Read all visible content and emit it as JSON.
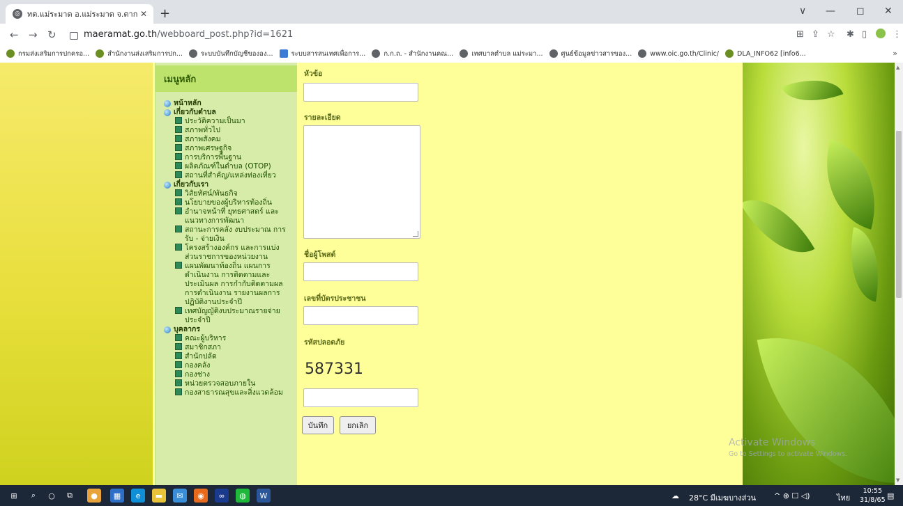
{
  "browser": {
    "tab_title": "ทต.แม่ระมาด อ.แม่ระมาด จ.ตาก - ma",
    "new_tab": "+",
    "url_domain": "maeramat.go.th",
    "url_path": "/webboard_post.php?id=1621",
    "window_controls": [
      "∨",
      "—",
      "◻",
      "✕"
    ]
  },
  "bookmarks": [
    {
      "label": "กรมส่งเสริมการปกครอ...",
      "icon": "site-icon"
    },
    {
      "label": "สำนักงานส่งเสริมการปก...",
      "icon": "site-icon"
    },
    {
      "label": "ระบบบันทึกบัญชีขององ...",
      "icon": "globe-icon"
    },
    {
      "label": "ระบบสารสนเทศเพื่อการ...",
      "icon": "doc-icon"
    },
    {
      "label": "ก.ก.ถ. - สำนักงานคณ...",
      "icon": "globe-icon"
    },
    {
      "label": "เทศบาลตำบล แม่ระมา...",
      "icon": "globe-icon"
    },
    {
      "label": "ศูนย์ข้อมูลข่าวสารของ...",
      "icon": "globe-icon"
    },
    {
      "label": "www.oic.go.th/Clinic/",
      "icon": "globe-icon"
    },
    {
      "label": "DLA_INFO62 [info6...",
      "icon": "site-icon"
    }
  ],
  "bookmarks_more": "»",
  "menu": {
    "header": "เมนูหลัก",
    "items": [
      {
        "type": "cat",
        "label": "หน้าหลัก"
      },
      {
        "type": "cat",
        "label": "เกี่ยวกับตำบล"
      },
      {
        "type": "sub",
        "label": "ประวัติความเป็นมา"
      },
      {
        "type": "sub",
        "label": "สภาพทั่วไป"
      },
      {
        "type": "sub",
        "label": "สภาพสังคม"
      },
      {
        "type": "sub",
        "label": "สภาพเศรษฐกิจ"
      },
      {
        "type": "sub",
        "label": "การบริการพื้นฐาน"
      },
      {
        "type": "sub",
        "label": "ผลิตภัณฑ์ในตำบล (OTOP)"
      },
      {
        "type": "sub",
        "label": "สถานที่สำคัญ/แหล่งท่องเที่ยว"
      },
      {
        "type": "cat",
        "label": "เกี่ยวกับเรา"
      },
      {
        "type": "sub",
        "label": "วิสัยทัศน์/พันธกิจ"
      },
      {
        "type": "sub",
        "label": "นโยบายของผู้บริหารท้องถิ่น"
      },
      {
        "type": "sub",
        "label": "อำนาจหน้าที่ ยุทธศาสตร์ และแนวทางการพัฒนา"
      },
      {
        "type": "sub",
        "label": "สถานะการคลัง งบประมาณ การรับ - จ่ายเงิน"
      },
      {
        "type": "sub",
        "label": "โครงสร้างองค์กร และการแบ่งส่วนราชการของหน่วยงาน"
      },
      {
        "type": "sub",
        "label": "แผนพัฒนาท้องถิ่น แผนการดำเนินงาน การติดตามและประเมินผล การกำกับติดตามผลการดำเนินงาน รายงานผลการปฏิบัติงานประจำปี"
      },
      {
        "type": "sub",
        "label": "เทศบัญญัติงบประมาณรายจ่ายประจำปี"
      },
      {
        "type": "cat",
        "label": "บุคลากร"
      },
      {
        "type": "sub",
        "label": "คณะผู้บริหาร"
      },
      {
        "type": "sub",
        "label": "สมาชิกสภา"
      },
      {
        "type": "sub",
        "label": "สำนักปลัด"
      },
      {
        "type": "sub",
        "label": "กองคลัง"
      },
      {
        "type": "sub",
        "label": "กองช่าง"
      },
      {
        "type": "sub",
        "label": "หน่วยตรวจสอบภายใน"
      },
      {
        "type": "sub",
        "label": "กองสาธารณสุขและสิ่งแวดล้อม"
      }
    ]
  },
  "form": {
    "topic_label": "หัวข้อ",
    "topic_value": "",
    "detail_label": "รายละเอียด",
    "detail_value": "",
    "poster_label": "ชื่อผู้โพสต์",
    "poster_value": "",
    "idcard_label": "เลขที่บัตรประชาชน",
    "idcard_value": "",
    "captcha_label": "รหัสปลอดภัย",
    "captcha_code": "587331",
    "captcha_value": "",
    "save_button": "บันทึก",
    "cancel_button": "ยกเลิก"
  },
  "watermark": {
    "line1": "Activate Windows",
    "line2": "Go to Settings to activate Windows."
  },
  "taskbar": {
    "weather": "28°C มีเมฆบางส่วน",
    "tray_icons": "^ ⊕ ☐ ◁)",
    "language": "ไทย",
    "time": "10:55",
    "date": "31/8/65"
  }
}
